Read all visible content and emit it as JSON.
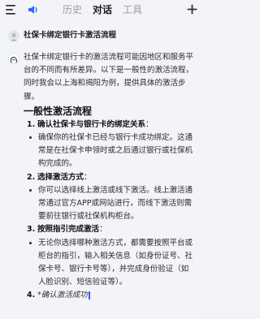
{
  "topbar": {
    "menu_icon": "hamburger-menu-icon",
    "speaker_icon": "speaker-icon",
    "tabs": [
      {
        "label": "历史",
        "active": false
      },
      {
        "label": "对话",
        "active": true
      },
      {
        "label": "工具",
        "active": false
      }
    ],
    "add_icon": "plus-icon",
    "accent_color": "#2f6bff"
  },
  "conversation": {
    "user_query": "社保卡绑定银行卡激活流程",
    "answer": {
      "intro": "社保卡绑定银行卡的激活流程可能因地区和服务平台的不同而有所差异。以下是一般性的激活流程，同时我会以上海和揭阳为例，提供具体的激活步骤。",
      "section_title": "一般性激活流程",
      "steps": [
        {
          "num": "1.",
          "title": "确认社保卡与银行卡的绑定关系",
          "colon": "：",
          "bullet": "确保你的社保卡已经与银行卡成功绑定。这通常是在社保卡申领时或之后通过银行或社保机构完成的。"
        },
        {
          "num": "2.",
          "title": "选择激活方式",
          "colon": "：",
          "bullet": "你可以选择线上激活或线下激活。线上激活通常通过官方APP或网站进行，而线下激活则需要前往银行或社保机构柜台。"
        },
        {
          "num": "3.",
          "title": "按照指引完成激活",
          "colon": "：",
          "bullet": "无论你选择哪种激活方式，都需要按照平台或柜台的指引，输入相关信息（如身份证号、社保卡号、银行卡号等），并完成身份验证（如人脸识别、短信验证等）。"
        }
      ],
      "trailing_num": "4.",
      "trailing_text": "*确认激活成功"
    }
  }
}
